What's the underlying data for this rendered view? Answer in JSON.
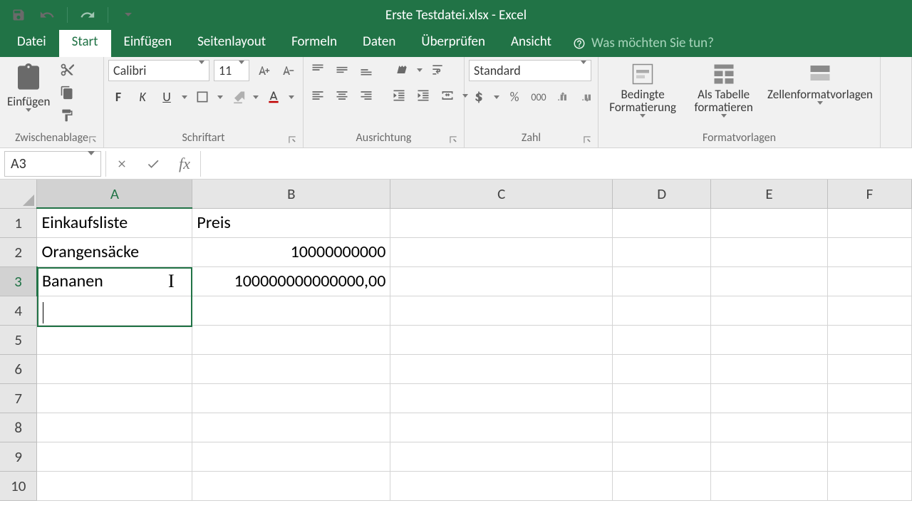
{
  "title": "Erste Testdatei.xlsx - Excel",
  "tabs": [
    "Datei",
    "Start",
    "Einfügen",
    "Seitenlayout",
    "Formeln",
    "Daten",
    "Überprüfen",
    "Ansicht"
  ],
  "active_tab": 1,
  "tellme_placeholder": "Was möchten Sie tun?",
  "ribbon": {
    "clipboard": {
      "paste": "Einfügen",
      "group": "Zwischenablage"
    },
    "font": {
      "name": "Calibri",
      "size": "11",
      "group": "Schriftart",
      "bold": "F",
      "italic": "K",
      "underline": "U"
    },
    "align": {
      "group": "Ausrichtung"
    },
    "number": {
      "format": "Standard",
      "group": "Zahl"
    },
    "styles": {
      "cond": "Bedingte Formatierung",
      "table": "Als Tabelle formatieren",
      "cell": "Zellenformatvorlagen",
      "group": "Formatvorlagen"
    }
  },
  "namebox": "A3",
  "formula": "",
  "columns": [
    "A",
    "B",
    "C",
    "D",
    "E",
    "F"
  ],
  "active_col": 0,
  "active_row": 3,
  "rows": [
    {
      "n": 1,
      "A": "Einkaufsliste",
      "B": "Preis"
    },
    {
      "n": 2,
      "A": "Orangensäcke",
      "B": "10000000000",
      "Bnum": true
    },
    {
      "n": 3,
      "A": "Bananen",
      "B": "100000000000000,00",
      "Bnum": true
    },
    {
      "n": 4
    },
    {
      "n": 5
    },
    {
      "n": 6
    },
    {
      "n": 7
    },
    {
      "n": 8
    },
    {
      "n": 9
    },
    {
      "n": 10
    }
  ]
}
